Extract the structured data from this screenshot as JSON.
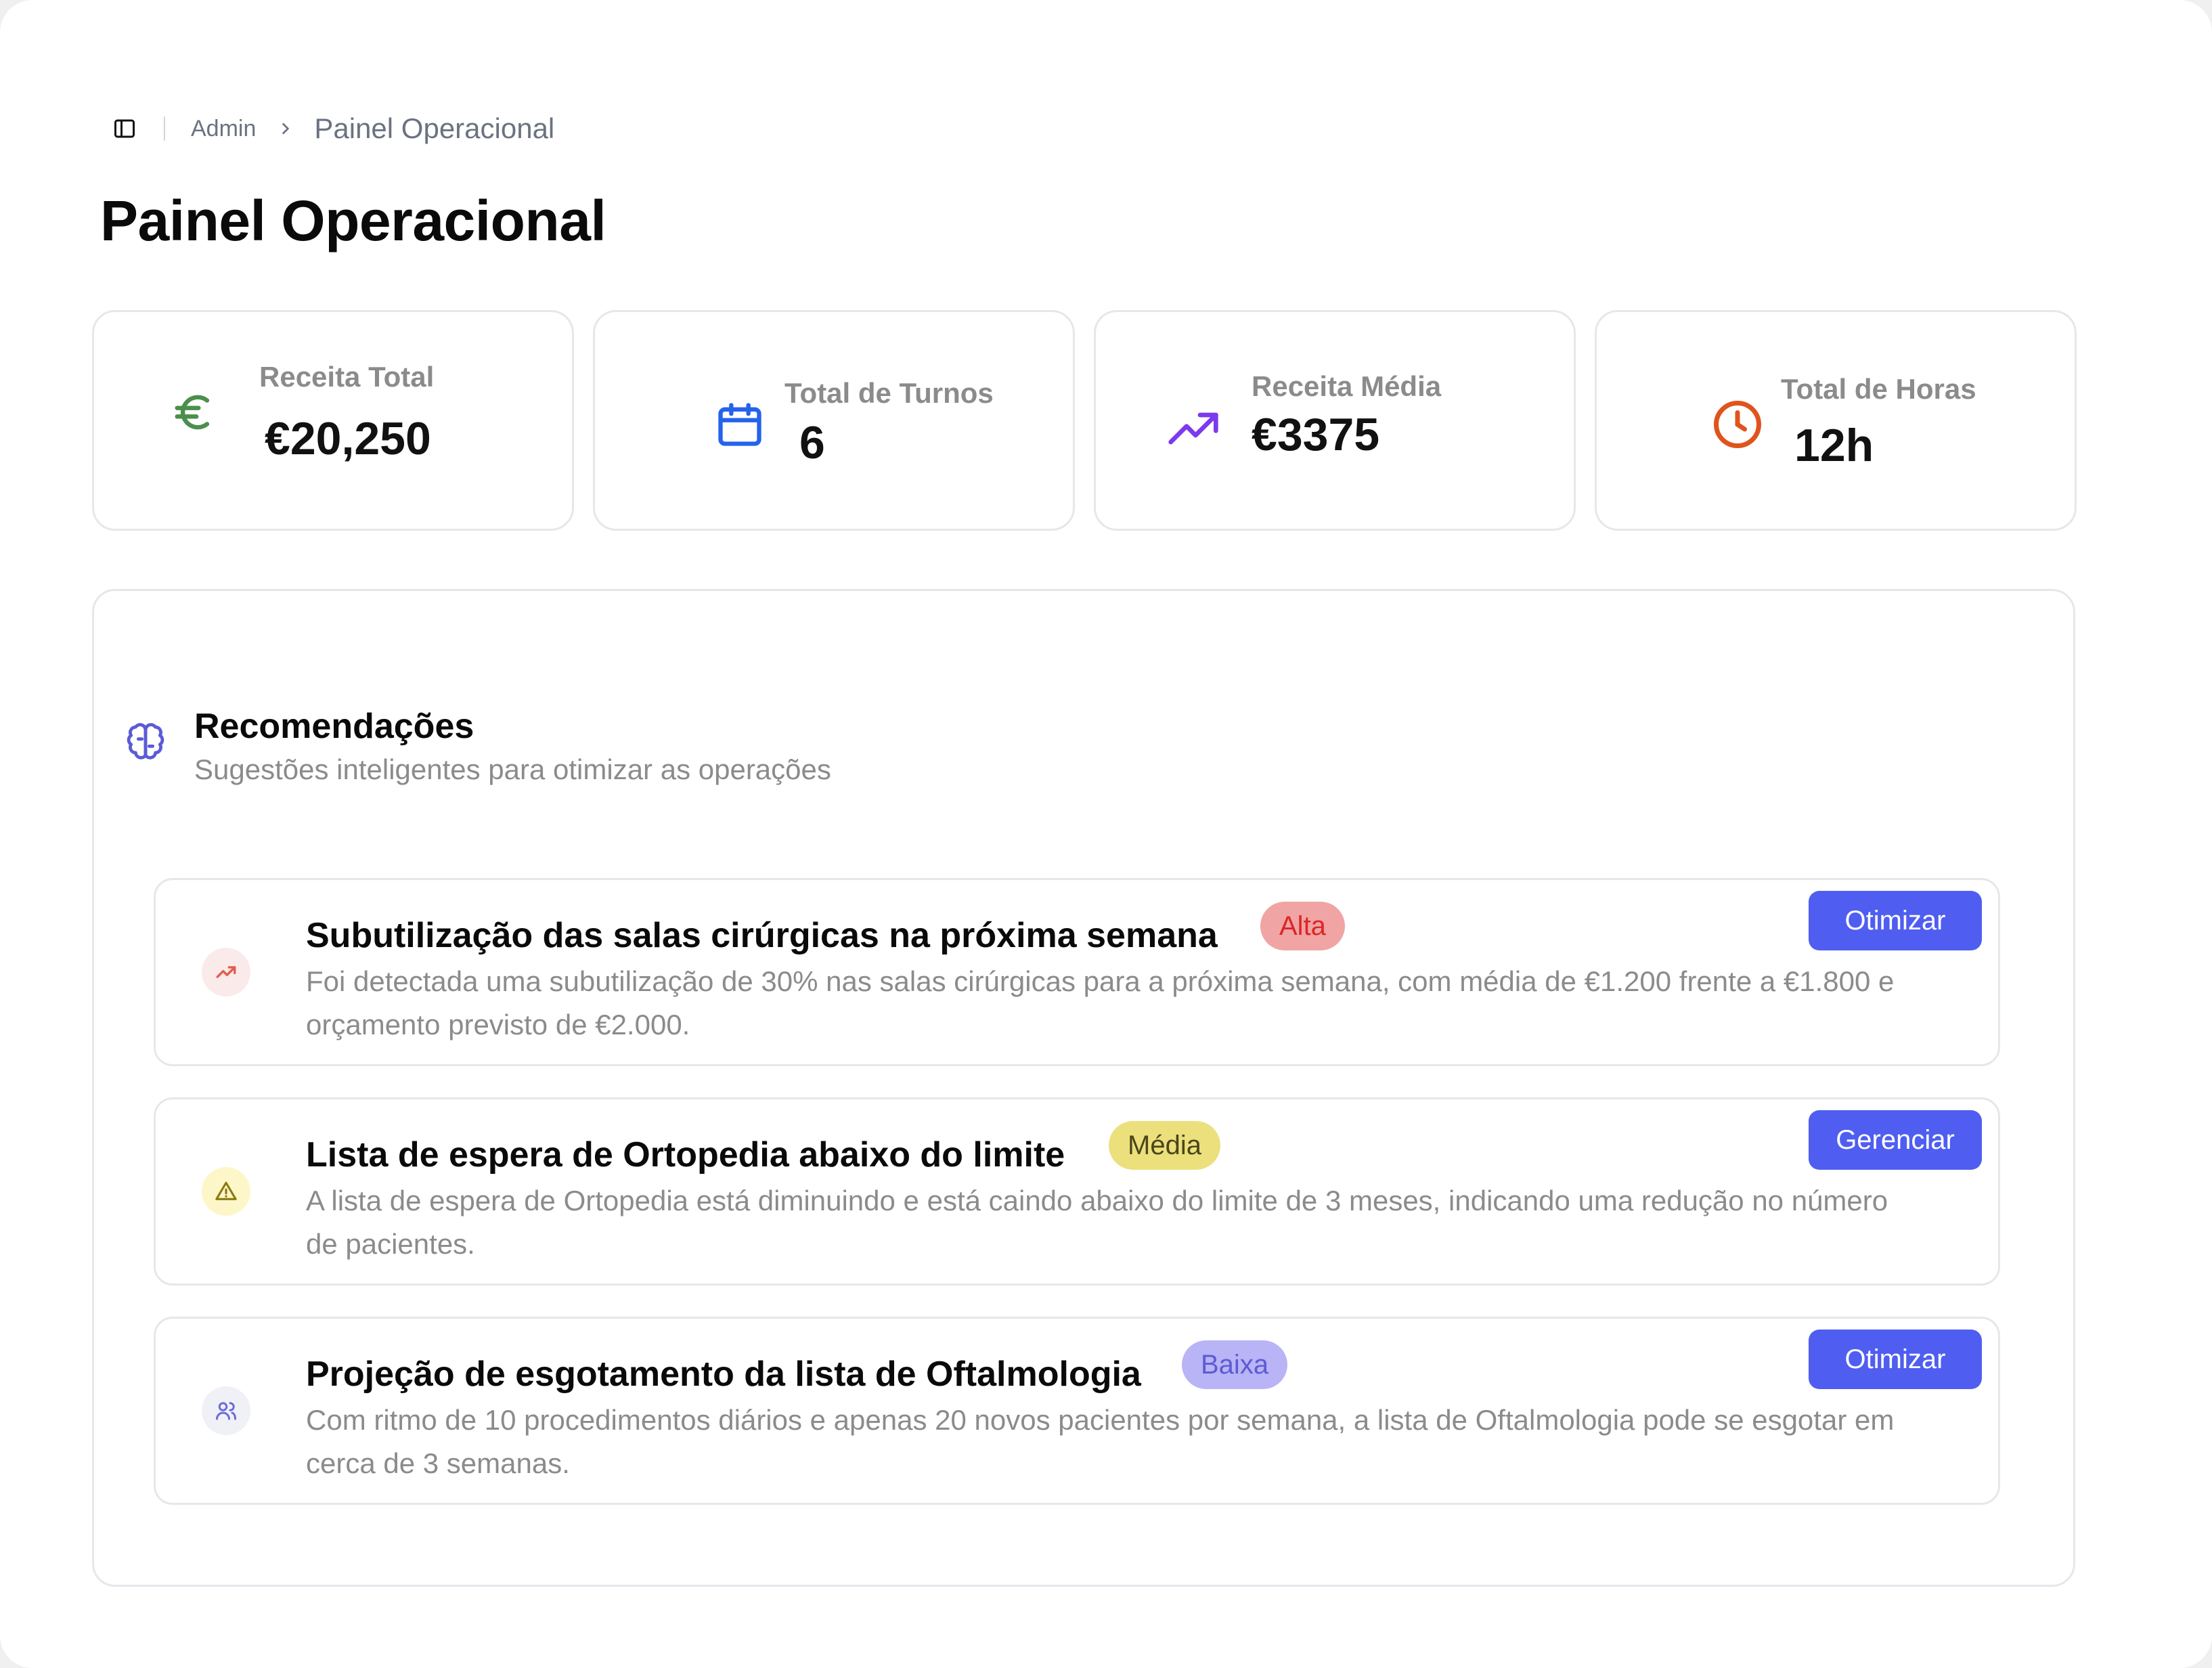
{
  "breadcrumb": {
    "root": "Admin",
    "current": "Painel Operacional"
  },
  "page_title": "Painel Operacional",
  "stats": [
    {
      "label": "Receita Total",
      "value": "€20,250",
      "icon": "euro-icon",
      "color": "#4a8f4a"
    },
    {
      "label": "Total de Turnos",
      "value": "6",
      "icon": "calendar-icon",
      "color": "#2563eb"
    },
    {
      "label": "Receita Média",
      "value": "€3375",
      "icon": "trending-up-icon",
      "color": "#7c3aed"
    },
    {
      "label": "Total de Horas",
      "value": "12h",
      "icon": "clock-icon",
      "color": "#e0531d"
    }
  ],
  "recommendations": {
    "title": "Recomendações",
    "subtitle": "Sugestões inteligentes para otimizar as operações",
    "icon": "brain-icon",
    "items": [
      {
        "title": "Subutilização das salas cirúrgicas na próxima semana",
        "priority": "Alta",
        "description": "Foi detectada uma subutilização de 30% nas salas cirúrgicas para a próxima semana, com média de €1.200 frente a €1.800 e orçamento previsto de €2.000.",
        "action": "Otimizar",
        "icon": "trending-up-icon"
      },
      {
        "title": "Lista de espera de Ortopedia abaixo do limite",
        "priority": "Média",
        "description": "A lista de espera de Ortopedia está diminuindo e está caindo abaixo do limite de 3 meses, indicando uma redução no número de pacientes.",
        "action": "Gerenciar",
        "icon": "warning-icon"
      },
      {
        "title": "Projeção de esgotamento da lista de Oftalmologia",
        "priority": "Baixa",
        "description": "Com ritmo de 10 procedimentos diários e apenas 20 novos pacientes por semana, a lista de Oftalmologia pode se esgotar em cerca de 3 semanas.",
        "action": "Otimizar",
        "icon": "users-icon"
      }
    ]
  },
  "colors": {
    "accent": "#4f5ef0",
    "priority_high_bg": "#f0a4a4",
    "priority_high_text": "#dc2626",
    "priority_medium_bg": "#ebe07c",
    "priority_medium_text": "#4a4518",
    "priority_low_bg": "#b8b4f5",
    "priority_low_text": "#5b5bd6"
  }
}
